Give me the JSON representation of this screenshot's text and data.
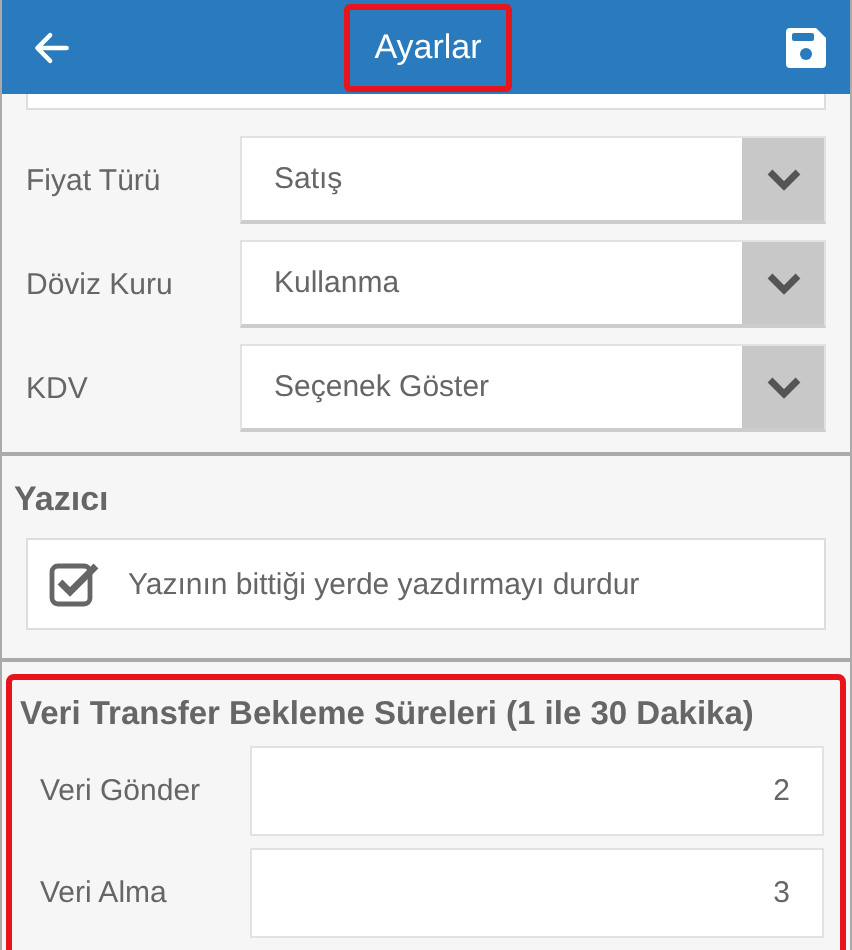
{
  "header": {
    "title": "Ayarlar",
    "title_highlighted": true
  },
  "selects": [
    {
      "label": "Fiyat Türü",
      "value": "Satış"
    },
    {
      "label": "Döviz Kuru",
      "value": "Kullanma"
    },
    {
      "label": "KDV",
      "value": "Seçenek Göster"
    }
  ],
  "printer": {
    "title": "Yazıcı",
    "option": {
      "label": "Yazının bittiği yerde yazdırmayı durdur",
      "checked": true
    }
  },
  "transfer": {
    "title": "Veri Transfer Bekleme Süreleri (1 ile 30 Dakika)",
    "highlighted": true,
    "fields": [
      {
        "label": "Veri Gönder",
        "value": "2"
      },
      {
        "label": "Veri Alma",
        "value": "3"
      }
    ]
  }
}
